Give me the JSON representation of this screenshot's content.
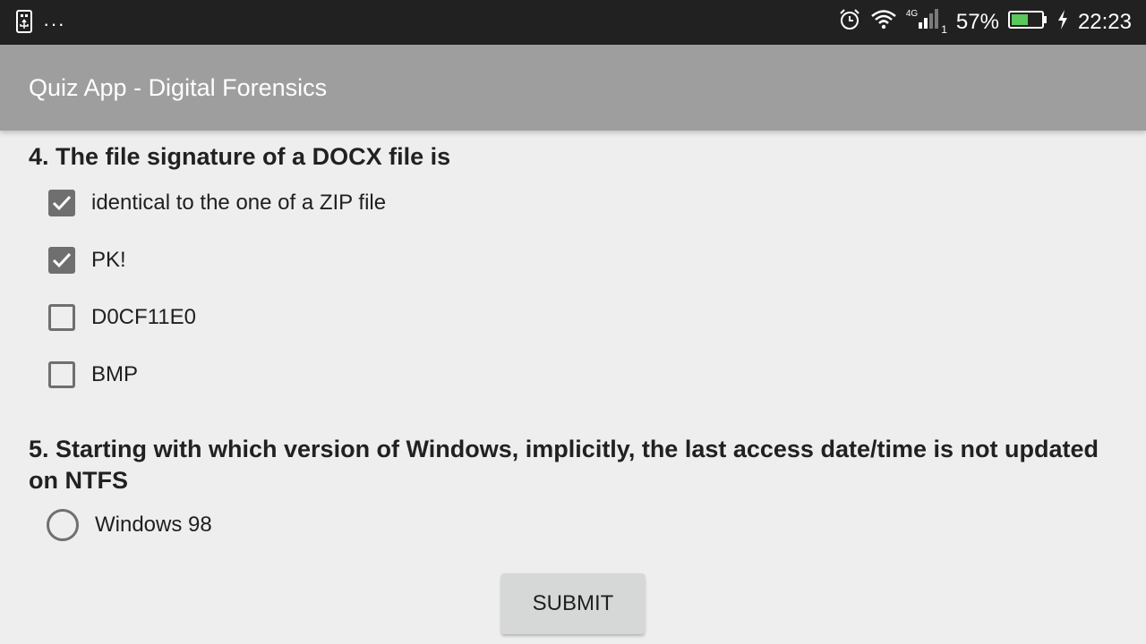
{
  "status_bar": {
    "dots": "···",
    "network_type": "4G",
    "sim_slot": "1",
    "battery_percent": "57%",
    "battery_level": 0.57,
    "time": "22:23",
    "icons": [
      "usb-icon",
      "alarm-icon",
      "wifi-icon",
      "signal-icon",
      "battery-icon",
      "charging-icon"
    ]
  },
  "app_bar": {
    "title": "Quiz App - Digital Forensics"
  },
  "questions": [
    {
      "text": "4. The file signature of a DOCX file is",
      "type": "checkbox",
      "options": [
        {
          "label": "identical to the one of a ZIP file",
          "checked": true
        },
        {
          "label": "PK!",
          "checked": true
        },
        {
          "label": "D0CF11E0",
          "checked": false
        },
        {
          "label": "BMP",
          "checked": false
        }
      ]
    },
    {
      "text": "5. Starting with which version of Windows, implicitly, the last access date/time is not updated on NTFS",
      "type": "radio",
      "options": [
        {
          "label": "Windows 98",
          "checked": false
        }
      ]
    }
  ],
  "submit_label": "SUBMIT",
  "colors": {
    "status_bar": "#212121",
    "app_bar": "#9e9e9e",
    "background": "#eeeeee",
    "control": "#6f6f6f",
    "battery_fill": "#5ac85a"
  }
}
